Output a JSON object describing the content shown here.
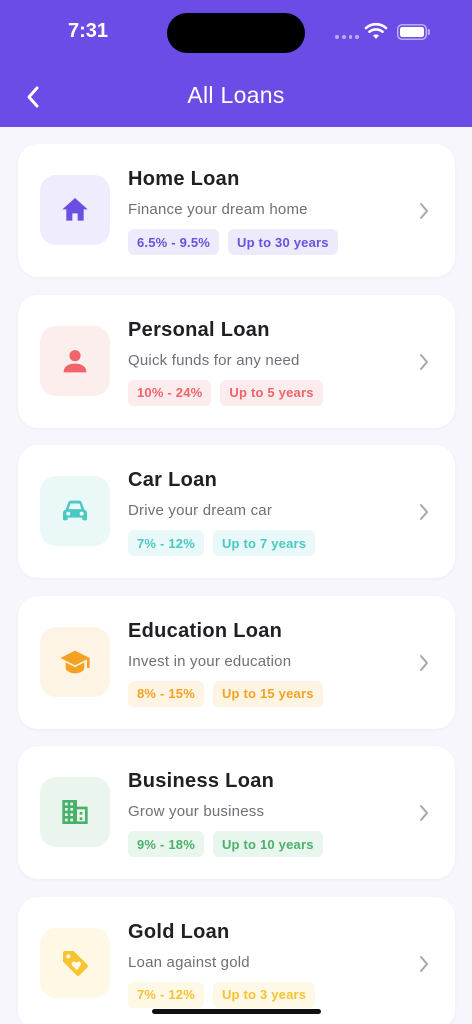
{
  "status_bar": {
    "time": "7:31"
  },
  "header": {
    "title": "All Loans"
  },
  "loans": [
    {
      "title": "Home Loan",
      "description": "Finance your dream home",
      "rate": "6.5% - 9.5%",
      "tenure": "Up to 30 years",
      "icon": "home-icon",
      "accent": "#6a4fe0",
      "bg": "#efecfd"
    },
    {
      "title": "Personal Loan",
      "description": "Quick funds for any need",
      "rate": "10% - 24%",
      "tenure": "Up to 5 years",
      "icon": "person-icon",
      "accent": "#f0646a",
      "bg": "#fdeeee"
    },
    {
      "title": "Car Loan",
      "description": "Drive your dream car",
      "rate": "7% - 12%",
      "tenure": "Up to 7 years",
      "icon": "car-icon",
      "accent": "#49c9c4",
      "bg": "#eaf8f8"
    },
    {
      "title": "Education Loan",
      "description": "Invest in your education",
      "rate": "8% - 15%",
      "tenure": "Up to 15 years",
      "icon": "graduation-cap-icon",
      "accent": "#f5a224",
      "bg": "#fef4e6"
    },
    {
      "title": "Business Loan",
      "description": "Grow your business",
      "rate": "9% - 18%",
      "tenure": "Up to 10 years",
      "icon": "building-icon",
      "accent": "#4bb16a",
      "bg": "#eaf6ed"
    },
    {
      "title": "Gold Loan",
      "description": "Loan against gold",
      "rate": "7% - 12%",
      "tenure": "Up to 3 years",
      "icon": "tag-heart-icon",
      "accent": "#f6c331",
      "bg": "#fef8e4"
    }
  ]
}
